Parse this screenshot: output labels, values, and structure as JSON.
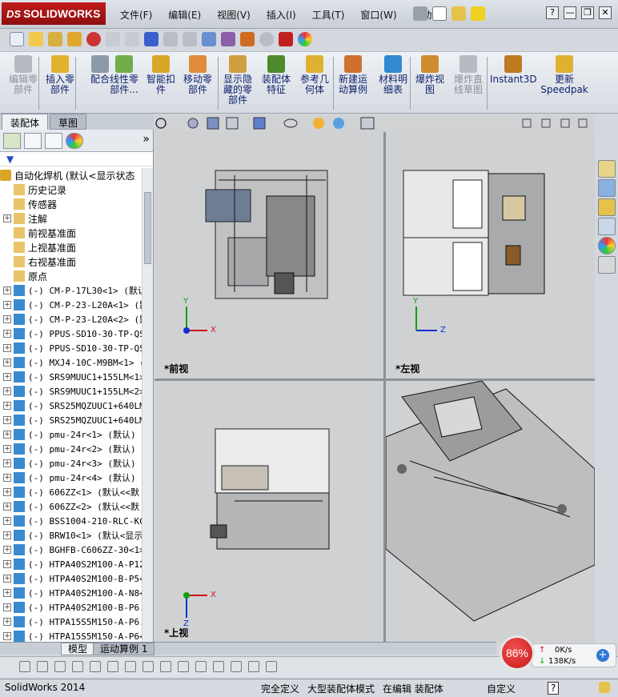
{
  "app": {
    "logo_prefix": "DS",
    "logo_text": "SOLIDWORKS"
  },
  "menu": [
    "文件(F)",
    "编辑(E)",
    "视图(V)",
    "插入(I)",
    "工具(T)",
    "窗口(W)",
    "帮助(H)"
  ],
  "window_controls": {
    "help": "?",
    "minimize": "—",
    "restore": "❐",
    "close": "✕"
  },
  "command_manager": [
    {
      "label": "编辑零\n部件",
      "enabled": false
    },
    {
      "label": "插入零\n部件",
      "enabled": true
    },
    {
      "label": "配合",
      "enabled": true
    },
    {
      "label": "线性零\n部件...",
      "enabled": true
    },
    {
      "label": "智能扣\n件",
      "enabled": true
    },
    {
      "label": "移动零\n部件",
      "enabled": true
    },
    {
      "label": "显示隐\n藏的零\n部件",
      "enabled": true
    },
    {
      "label": "装配体\n特征",
      "enabled": true
    },
    {
      "label": "参考几\n何体",
      "enabled": true
    },
    {
      "label": "新建运\n动算例",
      "enabled": true
    },
    {
      "label": "材料明\n细表",
      "enabled": true
    },
    {
      "label": "爆炸视\n图",
      "enabled": true
    },
    {
      "label": "爆炸直\n线草图",
      "enabled": false
    },
    {
      "label": "Instant3D",
      "enabled": true
    },
    {
      "label": "更新\nSpeedpak",
      "enabled": true
    }
  ],
  "left_tabs": {
    "assembly": "装配体",
    "sketch": "草图"
  },
  "tree": {
    "root": "自动化焊机  (默认<显示状态",
    "items": [
      {
        "label": "历史记录",
        "expandable": false,
        "cjk": true
      },
      {
        "label": "传感器",
        "expandable": false,
        "cjk": true
      },
      {
        "label": "注解",
        "expandable": true,
        "cjk": true
      },
      {
        "label": "前视基准面",
        "expandable": false,
        "cjk": true
      },
      {
        "label": "上视基准面",
        "expandable": false,
        "cjk": true
      },
      {
        "label": "右视基准面",
        "expandable": false,
        "cjk": true
      },
      {
        "label": "原点",
        "expandable": false,
        "cjk": true
      },
      {
        "label": "(-) CM-P-17L30<1> (默认",
        "expandable": true,
        "cjk": false
      },
      {
        "label": "(-) CM-P-23-L20A<1> (默",
        "expandable": true,
        "cjk": false
      },
      {
        "label": "(-) CM-P-23-L20A<2> (默",
        "expandable": true,
        "cjk": false
      },
      {
        "label": "(-) PPUS-SD10-30-TP-QS",
        "expandable": true,
        "cjk": false
      },
      {
        "label": "(-) PPUS-SD10-30-TP-QS",
        "expandable": true,
        "cjk": false
      },
      {
        "label": "(-) MXJ4-10C-M9BM<1> (",
        "expandable": true,
        "cjk": false
      },
      {
        "label": "(-) SRS9MUUC1+155LM<1>",
        "expandable": true,
        "cjk": false
      },
      {
        "label": "(-) SRS9MUUC1+155LM<2>",
        "expandable": true,
        "cjk": false
      },
      {
        "label": "(-) SRS25MQZUUC1+640LM",
        "expandable": true,
        "cjk": false
      },
      {
        "label": "(-) SRS25MQZUUC1+640LM",
        "expandable": true,
        "cjk": false
      },
      {
        "label": "(-) pmu-24r<1> (默认)",
        "expandable": true,
        "cjk": false
      },
      {
        "label": "(-) pmu-24r<2> (默认)",
        "expandable": true,
        "cjk": false
      },
      {
        "label": "(-) pmu-24r<3> (默认)",
        "expandable": true,
        "cjk": false
      },
      {
        "label": "(-) pmu-24r<4> (默认)",
        "expandable": true,
        "cjk": false
      },
      {
        "label": "(-) 606ZZ<1> (默认<<默",
        "expandable": true,
        "cjk": false
      },
      {
        "label": "(-) 606ZZ<2> (默认<<默",
        "expandable": true,
        "cjk": false
      },
      {
        "label": "(-) BSS1004-210-RLC-KC",
        "expandable": true,
        "cjk": false
      },
      {
        "label": "(-) BRW10<1> (默认<显示",
        "expandable": true,
        "cjk": false
      },
      {
        "label": "(-) BGHFB-C606ZZ-30<1>",
        "expandable": true,
        "cjk": false
      },
      {
        "label": "(-) HTPA40S2M100-A-P12",
        "expandable": true,
        "cjk": false
      },
      {
        "label": "(-) HTPA40S2M100-B-P5<",
        "expandable": true,
        "cjk": false
      },
      {
        "label": "(-) HTPA40S2M100-A-N8<",
        "expandable": true,
        "cjk": false
      },
      {
        "label": "(-) HTPA40S2M100-B-P6.",
        "expandable": true,
        "cjk": false
      },
      {
        "label": "(-) HTPA15S5M150-A-P6.",
        "expandable": true,
        "cjk": false
      },
      {
        "label": "(-) HTPA15S5M150-A-P6<",
        "expandable": true,
        "cjk": false
      }
    ]
  },
  "viewports": {
    "front": "*前视",
    "left": "*左视",
    "top": "*上视"
  },
  "axes": {
    "x": "X",
    "y": "Y",
    "z": "Z"
  },
  "bottom_tabs": {
    "model": "模型",
    "motion": "运动算例 1"
  },
  "status": {
    "app_version": "SolidWorks 2014",
    "fully_defined": "完全定义",
    "large_assembly": "大型装配体模式",
    "editing": "在编辑 装配体",
    "custom": "自定义",
    "help": "?"
  },
  "network": {
    "percent": "86%",
    "upload": "0K/s",
    "download": "138K/s",
    "upload_arrow": "↑",
    "download_arrow": "↓",
    "plus": "+"
  },
  "colors": {
    "brand": "#b01414",
    "axis_x": "#d01010",
    "axis_y": "#10a010",
    "axis_z": "#1030d0",
    "network_ring": "#c81818"
  }
}
